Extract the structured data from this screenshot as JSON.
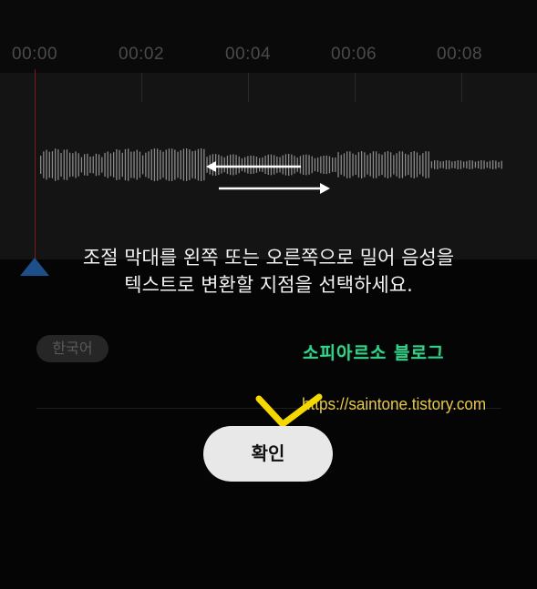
{
  "timeline": {
    "ticks": [
      "00:00",
      "00:02",
      "00:04",
      "00:06",
      "00:08"
    ]
  },
  "instruction": {
    "line1": "조절 막대를 왼쪽 또는 오른쪽으로 밀어 음성을",
    "line2": "텍스트로 변환할 지점을 선택하세요."
  },
  "language_chip": "한국어",
  "confirm_button": "확인",
  "watermark": {
    "title": "소피아르소 블로그",
    "url": "https://saintone.tistory.com"
  },
  "colors": {
    "background": "#050505",
    "waveform": "#8a8a8a",
    "playhead": "#7a1a1a",
    "handle": "#1d4f8a",
    "button": "#e8e8e8",
    "watermark_title": "#38d08a",
    "watermark_url": "#e6c94a",
    "checkmark": "#f5d800"
  },
  "icons": [
    "playhead-handle-icon",
    "left-arrow-icon",
    "right-arrow-icon",
    "checkmark-icon"
  ]
}
